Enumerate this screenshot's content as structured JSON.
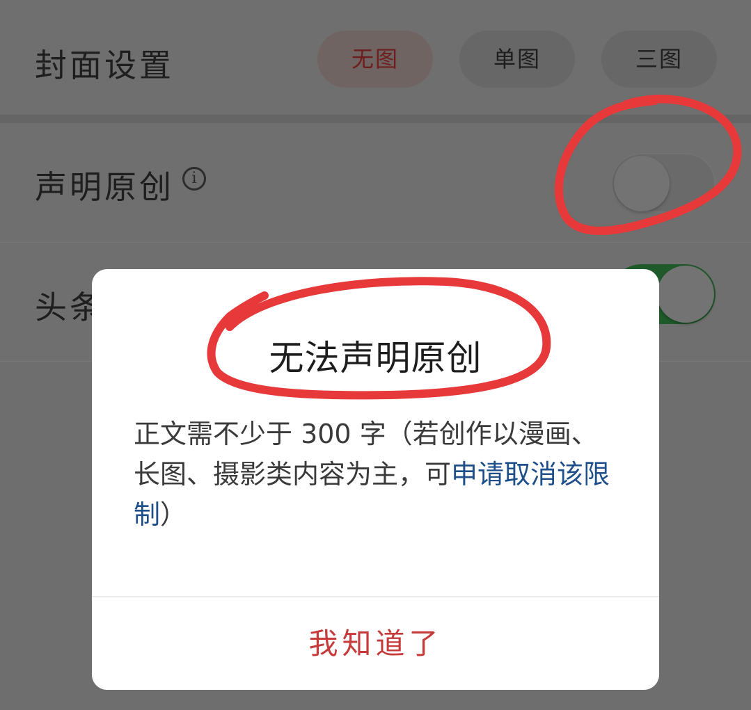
{
  "settings": {
    "cover": {
      "label": "封面设置",
      "options": [
        "无图",
        "单图",
        "三图"
      ],
      "selected": "无图"
    },
    "original": {
      "label": "声明原创",
      "info_icon": "i",
      "enabled": false
    },
    "headline": {
      "label": "头条",
      "enabled": true
    }
  },
  "dialog": {
    "title": "无法声明原创",
    "message_prefix": "正文需不少于 300 字（若创作以漫画、长图、摄影类内容为主，可",
    "message_link": "申请取消该限制",
    "message_suffix": "）",
    "button_label": "我知道了"
  },
  "colors": {
    "accent_red": "#c63a3a",
    "link_blue": "#1e4f8a",
    "annotation_red": "#e8393a",
    "toggle_on_green": "#2e9e44"
  }
}
